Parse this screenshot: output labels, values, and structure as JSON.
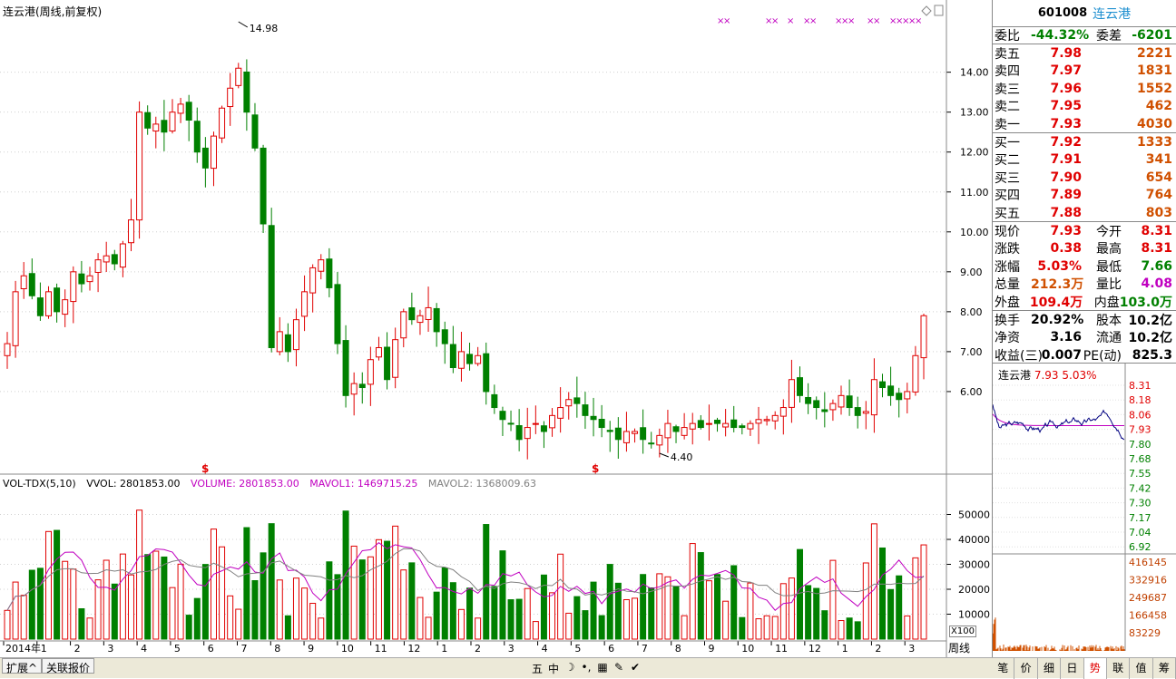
{
  "title": "连云港(周线,前复权)",
  "volume_legend": {
    "indicator": "VOL-TDX(5,10)",
    "vvol": "VVOL: 2801853.00",
    "volume": "VOLUME: 2801853.00",
    "mavol1": "MAVOL1: 1469715.25",
    "mavol2": "MAVOL2: 1368009.63"
  },
  "colors": {
    "up": "#e00000",
    "down": "#008000",
    "ma1": "#c000c0",
    "ma2": "#808080",
    "grid": "#d0d0d0"
  },
  "chart_data": {
    "type": "candlestick",
    "price_axis": {
      "ylim": [
        4.0,
        15.4
      ],
      "ticks": [
        "14.00",
        "13.00",
        "12.00",
        "11.00",
        "10.00",
        "9.00",
        "8.00",
        "7.00",
        "6.00"
      ]
    },
    "volume_axis": {
      "ylim": [
        0,
        60000
      ],
      "ticks": [
        "50000",
        "40000",
        "30000",
        "20000",
        "10000"
      ],
      "unit": "X100"
    },
    "x_ticks": [
      "2014年",
      "1",
      "2",
      "3",
      "4",
      "5",
      "6",
      "7",
      "8",
      "9",
      "10",
      "11",
      "12",
      "1",
      "2",
      "3",
      "4",
      "5",
      "6",
      "7",
      "8",
      "9",
      "10",
      "11",
      "12",
      "1",
      "2",
      "3"
    ],
    "annotations": {
      "high": "14.98",
      "low": "4.40"
    },
    "closes": [
      7.2,
      8.5,
      8.9,
      8.4,
      7.9,
      8.5,
      8.0,
      8.3,
      9.0,
      8.7,
      8.9,
      9.3,
      9.4,
      9.2,
      9.7,
      10.3,
      13.0,
      12.6,
      12.7,
      12.5,
      13.0,
      13.2,
      12.8,
      12.0,
      11.6,
      12.4,
      13.1,
      13.6,
      14.1,
      13.0,
      12.1,
      10.2,
      7.1,
      7.5,
      7.0,
      7.8,
      8.5,
      9.1,
      9.3,
      8.6,
      7.2,
      5.9,
      6.2,
      6.1,
      6.8,
      7.1,
      6.3,
      7.3,
      8.0,
      7.8,
      7.9,
      8.1,
      7.5,
      7.2,
      6.6,
      7.0,
      6.7,
      6.9,
      6.0,
      5.6,
      5.3,
      5.2,
      4.8,
      5.1,
      5.2,
      5.0,
      5.4,
      5.6,
      5.8,
      5.7,
      5.4,
      5.3,
      5.1,
      5.0,
      4.8,
      5.0,
      5.0,
      4.8,
      4.7,
      4.9,
      5.2,
      5.0,
      5.1,
      5.2,
      5.1,
      5.2,
      5.2,
      5.2,
      5.1,
      5.1,
      5.2,
      5.3,
      5.3,
      5.4,
      5.6,
      6.3,
      5.9,
      5.7,
      5.6,
      5.5,
      5.7,
      5.9,
      5.6,
      5.4,
      5.5,
      6.3,
      6.1,
      5.9,
      5.8,
      6.0,
      6.9,
      7.9
    ]
  },
  "right_panel": {
    "code": "601008",
    "name": "连云港",
    "weibi_label": "委比",
    "weibi": "-44.32%",
    "weicha_label": "委差",
    "weicha": "-6201",
    "asks": [
      {
        "label": "卖五",
        "price": "7.98",
        "vol": "2221"
      },
      {
        "label": "卖四",
        "price": "7.97",
        "vol": "1831"
      },
      {
        "label": "卖三",
        "price": "7.96",
        "vol": "1552"
      },
      {
        "label": "卖二",
        "price": "7.95",
        "vol": "462"
      },
      {
        "label": "卖一",
        "price": "7.93",
        "vol": "4030"
      }
    ],
    "bids": [
      {
        "label": "买一",
        "price": "7.92",
        "vol": "1333"
      },
      {
        "label": "买二",
        "price": "7.91",
        "vol": "341"
      },
      {
        "label": "买三",
        "price": "7.90",
        "vol": "654"
      },
      {
        "label": "买四",
        "price": "7.89",
        "vol": "764"
      },
      {
        "label": "买五",
        "price": "7.88",
        "vol": "803"
      }
    ],
    "stats1": [
      {
        "l1": "现价",
        "v1": "7.93",
        "l2": "今开",
        "v2": "8.31"
      },
      {
        "l1": "涨跌",
        "v1": "0.38",
        "l2": "最高",
        "v2": "8.31"
      },
      {
        "l1": "涨幅",
        "v1": "5.03%",
        "l2": "最低",
        "v2": "7.66"
      },
      {
        "l1": "总量",
        "v1": "212.3万",
        "l2": "量比",
        "v2": "4.08"
      },
      {
        "l1": "外盘",
        "v1": "109.4万",
        "l2": "内盘",
        "v2": "103.0万"
      }
    ],
    "stats2": [
      {
        "l1": "换手",
        "v1": "20.92%",
        "l2": "股本",
        "v2": "10.2亿"
      },
      {
        "l1": "净资",
        "v1": "3.16",
        "l2": "流通",
        "v2": "10.2亿"
      },
      {
        "l1": "收益(三)",
        "v1": "0.007",
        "l2": "PE(动)",
        "v2": "825.3"
      }
    ],
    "mini_chart": {
      "name": "连云港",
      "price": "7.93",
      "pct": "5.03%",
      "price_ticks": [
        "8.31",
        "8.18",
        "8.06",
        "7.93",
        "7.80",
        "7.68",
        "7.55",
        "7.42",
        "7.30",
        "7.17",
        "7.04",
        "6.92"
      ],
      "vol_ticks": [
        "416145",
        "332916",
        "249687",
        "166458",
        "83229"
      ]
    }
  },
  "bottom_bar": {
    "tabs": [
      "扩展^",
      "关联报价"
    ],
    "toolbar_icons": [
      "五",
      "中",
      "☽",
      "•,",
      "▦",
      "✎",
      "✔"
    ],
    "right_tabs": [
      "笔",
      "价",
      "细",
      "日",
      "势",
      "联",
      "值",
      "筹"
    ],
    "active_right_tab": "势",
    "period": "周线"
  }
}
